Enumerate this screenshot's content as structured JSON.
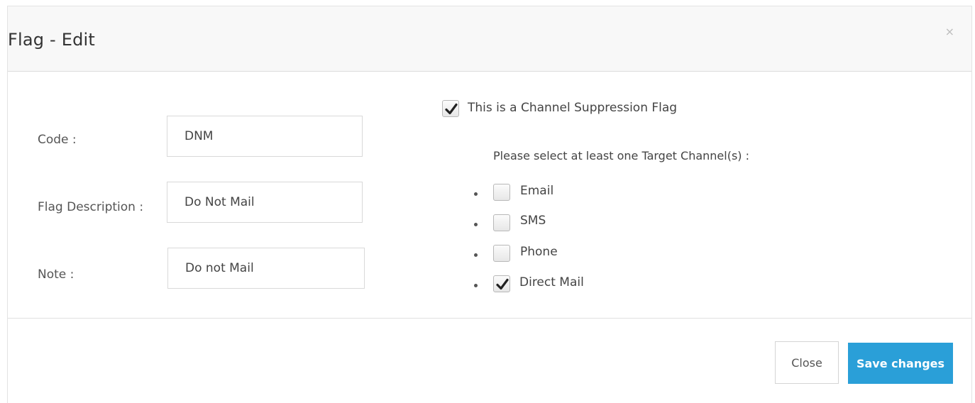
{
  "modal": {
    "title": "Flag - Edit",
    "close_icon": "×"
  },
  "form": {
    "code": {
      "label": "Code :",
      "value": "DNM"
    },
    "description": {
      "label": "Flag Description :",
      "value": "Do Not Mail"
    },
    "note": {
      "label": "Note :",
      "value": "Do not Mail"
    }
  },
  "suppression": {
    "label": "This is a Channel Suppression Flag",
    "checked": true,
    "prompt": "Please select at least one Target Channel(s) :",
    "channels": [
      {
        "label": "Email",
        "checked": false
      },
      {
        "label": "SMS",
        "checked": false
      },
      {
        "label": "Phone",
        "checked": false
      },
      {
        "label": "Direct Mail",
        "checked": true
      }
    ]
  },
  "footer": {
    "close_label": "Close",
    "save_label": "Save changes"
  },
  "colors": {
    "primary": "#2a9fd8",
    "header_bg": "#f8f8f8"
  }
}
